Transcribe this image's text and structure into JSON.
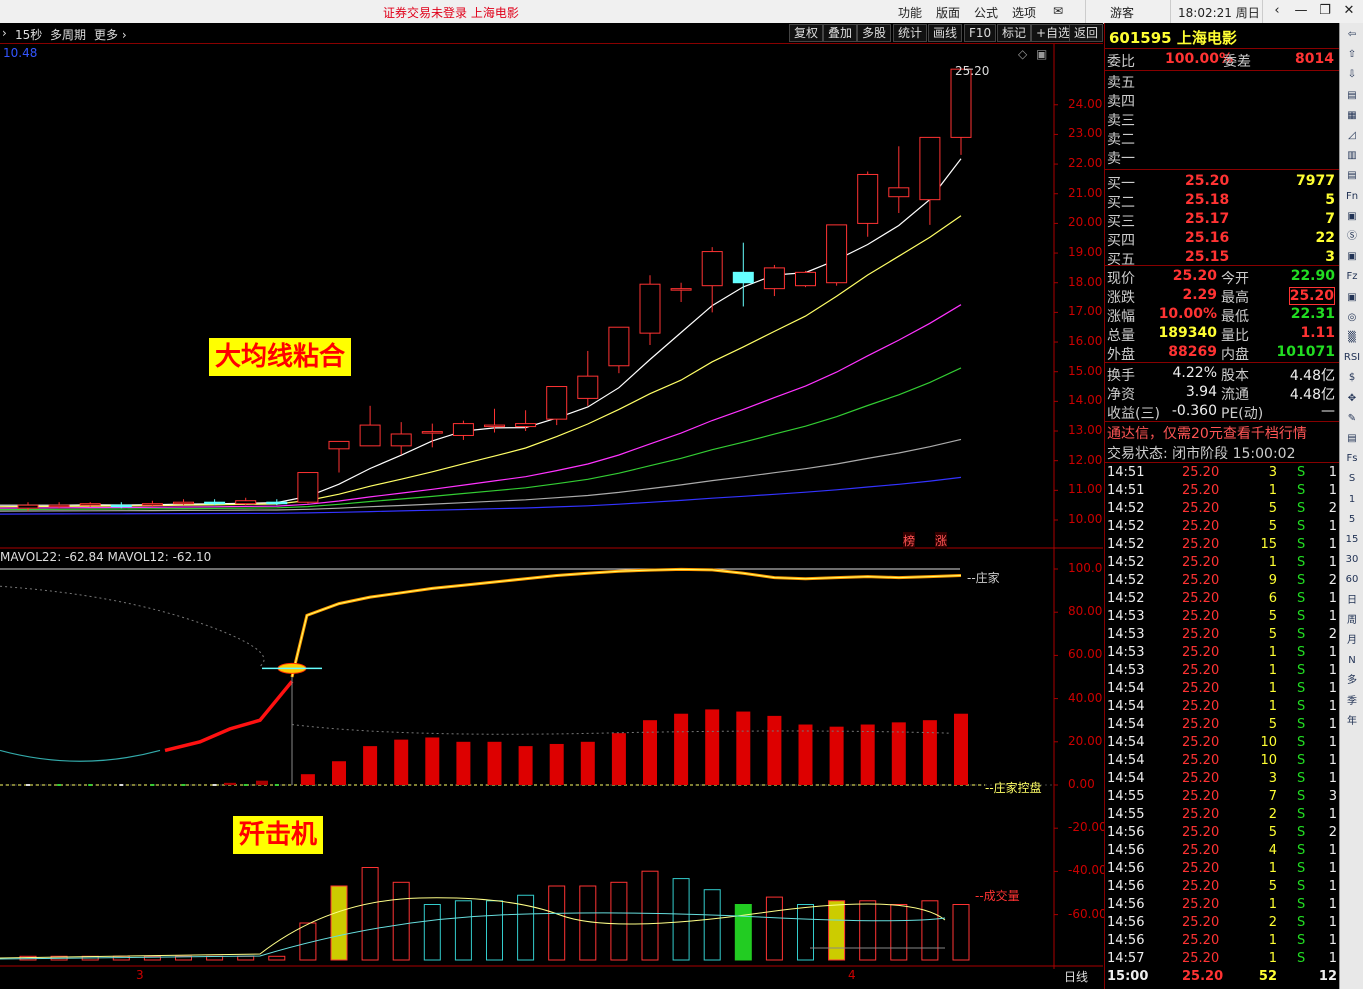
{
  "titlebar": {
    "center_text": "证券交易未登录  上海电影",
    "menu": [
      "功能",
      "版面",
      "公式",
      "选项"
    ],
    "user": "游客",
    "time": "18:02:21 周日"
  },
  "toolbar": {
    "left_items": [
      "15秒",
      "多周期",
      "更多 ›"
    ],
    "buttons": [
      "复权",
      "叠加",
      "多股",
      "统计",
      "画线",
      "F10",
      "标记",
      "+自选",
      "返回"
    ]
  },
  "main_chart": {
    "top_left_value": "10.48",
    "max_price_label": "25.20",
    "price_ticks": [
      "24.00",
      "23.00",
      "22.00",
      "21.00",
      "20.00",
      "19.00",
      "18.00",
      "17.00",
      "16.00",
      "15.00",
      "14.00",
      "13.00",
      "12.00",
      "11.00",
      "10.00"
    ],
    "annotation": "大均线粘合",
    "badges": [
      "榜",
      "涨"
    ]
  },
  "indicator_panel": {
    "header": "MAVOL22: -62.84  MAVOL12: -62.10",
    "ticks": [
      "100.0",
      "80.00",
      "60.00",
      "40.00",
      "20.00",
      "0.00",
      "-20.00",
      "-40.00",
      "-60.00"
    ],
    "label_zhuangjia": "--庄家",
    "label_kongpan": "--庄家控盘",
    "label_volume": "--成交量",
    "annotation": "歼击机",
    "date_labels": [
      "3",
      "4"
    ],
    "period": "日线"
  },
  "quote": {
    "code": "601595",
    "name": "上海电影",
    "weibi_label": "委比",
    "weibi_value": "100.00%",
    "weicha_label": "委差",
    "weicha_value": "8014",
    "sell_labels": [
      "卖五",
      "卖四",
      "卖三",
      "卖二",
      "卖一"
    ],
    "buys": [
      {
        "label": "买一",
        "price": "25.20",
        "vol": "7977"
      },
      {
        "label": "买二",
        "price": "25.18",
        "vol": "5"
      },
      {
        "label": "买三",
        "price": "25.17",
        "vol": "7"
      },
      {
        "label": "买四",
        "price": "25.16",
        "vol": "22"
      },
      {
        "label": "买五",
        "price": "25.15",
        "vol": "3"
      }
    ],
    "stats": [
      {
        "l1": "现价",
        "v1": "25.20",
        "l2": "今开",
        "v2": "22.90"
      },
      {
        "l1": "涨跌",
        "v1": "2.29",
        "l2": "最高",
        "v2": "25.20"
      },
      {
        "l1": "涨幅",
        "v1": "10.00%",
        "l2": "最低",
        "v2": "22.31"
      },
      {
        "l1": "总量",
        "v1": "189340",
        "l2": "量比",
        "v2": "1.11"
      },
      {
        "l1": "外盘",
        "v1": "88269",
        "l2": "内盘",
        "v2": "101071"
      }
    ],
    "stats2": [
      {
        "l1": "换手",
        "v1": "4.22%",
        "l2": "股本",
        "v2": "4.48亿"
      },
      {
        "l1": "净资",
        "v1": "3.94",
        "l2": "流通",
        "v2": "4.48亿"
      },
      {
        "l1": "收益(三)",
        "v1": "-0.360",
        "l2": "PE(动)",
        "v2": "—"
      }
    ],
    "ad": "通达信，仅需20元查看千档行情",
    "status": "交易状态: 闭市阶段 15:00:02"
  },
  "trades": [
    {
      "t": "14:51",
      "p": "25.20",
      "v": "3",
      "s": "S",
      "n": "1"
    },
    {
      "t": "14:51",
      "p": "25.20",
      "v": "1",
      "s": "S",
      "n": "1"
    },
    {
      "t": "14:52",
      "p": "25.20",
      "v": "5",
      "s": "S",
      "n": "2"
    },
    {
      "t": "14:52",
      "p": "25.20",
      "v": "5",
      "s": "S",
      "n": "1"
    },
    {
      "t": "14:52",
      "p": "25.20",
      "v": "15",
      "s": "S",
      "n": "1"
    },
    {
      "t": "14:52",
      "p": "25.20",
      "v": "1",
      "s": "S",
      "n": "1"
    },
    {
      "t": "14:52",
      "p": "25.20",
      "v": "9",
      "s": "S",
      "n": "2"
    },
    {
      "t": "14:52",
      "p": "25.20",
      "v": "6",
      "s": "S",
      "n": "1"
    },
    {
      "t": "14:53",
      "p": "25.20",
      "v": "5",
      "s": "S",
      "n": "1"
    },
    {
      "t": "14:53",
      "p": "25.20",
      "v": "5",
      "s": "S",
      "n": "2"
    },
    {
      "t": "14:53",
      "p": "25.20",
      "v": "1",
      "s": "S",
      "n": "1"
    },
    {
      "t": "14:53",
      "p": "25.20",
      "v": "1",
      "s": "S",
      "n": "1"
    },
    {
      "t": "14:54",
      "p": "25.20",
      "v": "1",
      "s": "S",
      "n": "1"
    },
    {
      "t": "14:54",
      "p": "25.20",
      "v": "1",
      "s": "S",
      "n": "1"
    },
    {
      "t": "14:54",
      "p": "25.20",
      "v": "5",
      "s": "S",
      "n": "1"
    },
    {
      "t": "14:54",
      "p": "25.20",
      "v": "10",
      "s": "S",
      "n": "1"
    },
    {
      "t": "14:54",
      "p": "25.20",
      "v": "10",
      "s": "S",
      "n": "1"
    },
    {
      "t": "14:54",
      "p": "25.20",
      "v": "3",
      "s": "S",
      "n": "1"
    },
    {
      "t": "14:55",
      "p": "25.20",
      "v": "7",
      "s": "S",
      "n": "3"
    },
    {
      "t": "14:55",
      "p": "25.20",
      "v": "2",
      "s": "S",
      "n": "1"
    },
    {
      "t": "14:56",
      "p": "25.20",
      "v": "5",
      "s": "S",
      "n": "2"
    },
    {
      "t": "14:56",
      "p": "25.20",
      "v": "4",
      "s": "S",
      "n": "1"
    },
    {
      "t": "14:56",
      "p": "25.20",
      "v": "1",
      "s": "S",
      "n": "1"
    },
    {
      "t": "14:56",
      "p": "25.20",
      "v": "5",
      "s": "S",
      "n": "1"
    },
    {
      "t": "14:56",
      "p": "25.20",
      "v": "1",
      "s": "S",
      "n": "1"
    },
    {
      "t": "14:56",
      "p": "25.20",
      "v": "2",
      "s": "S",
      "n": "1"
    },
    {
      "t": "14:56",
      "p": "25.20",
      "v": "1",
      "s": "S",
      "n": "1"
    },
    {
      "t": "14:57",
      "p": "25.20",
      "v": "1",
      "s": "S",
      "n": "1"
    },
    {
      "t": "15:00",
      "p": "25.20",
      "v": "52",
      "s": "",
      "n": "12"
    }
  ],
  "side_icons": [
    "⇦",
    "⇧",
    "⇩",
    "▤",
    "▦",
    "◿",
    "▥",
    "▤",
    "Fn",
    "▣",
    "Ⓢ",
    "▣",
    "Fz",
    "▣",
    "◎",
    "▒",
    "RSI",
    "$",
    "✥",
    "✎",
    "▤",
    "Fs",
    "S",
    "1",
    "5",
    "15",
    "30",
    "60",
    "日",
    "周",
    "月",
    "N",
    "多",
    "季",
    "年"
  ],
  "chart_data": {
    "type": "candlestick",
    "candles": [
      {
        "o": 10.4,
        "c": 10.5,
        "h": 10.6,
        "l": 10.3
      },
      {
        "o": 10.45,
        "c": 10.5,
        "h": 10.6,
        "l": 10.4
      },
      {
        "o": 10.5,
        "c": 10.55,
        "h": 10.6,
        "l": 10.45
      },
      {
        "o": 10.5,
        "c": 10.48,
        "h": 10.6,
        "l": 10.4
      },
      {
        "o": 10.5,
        "c": 10.55,
        "h": 10.65,
        "l": 10.45
      },
      {
        "o": 10.55,
        "c": 10.6,
        "h": 10.7,
        "l": 10.5
      },
      {
        "o": 10.6,
        "c": 10.55,
        "h": 10.7,
        "l": 10.5
      },
      {
        "o": 10.55,
        "c": 10.65,
        "h": 10.75,
        "l": 10.5
      },
      {
        "o": 10.6,
        "c": 10.58,
        "h": 10.7,
        "l": 10.5
      },
      {
        "o": 10.6,
        "c": 11.6,
        "h": 11.6,
        "l": 10.55
      },
      {
        "o": 12.4,
        "c": 12.65,
        "h": 12.65,
        "l": 11.6
      },
      {
        "o": 12.5,
        "c": 13.2,
        "h": 13.85,
        "l": 12.5
      },
      {
        "o": 12.5,
        "c": 12.9,
        "h": 13.3,
        "l": 12.2
      },
      {
        "o": 12.95,
        "c": 12.98,
        "h": 13.25,
        "l": 12.45
      },
      {
        "o": 12.85,
        "c": 13.25,
        "h": 13.35,
        "l": 12.7
      },
      {
        "o": 13.15,
        "c": 13.2,
        "h": 13.75,
        "l": 12.95
      },
      {
        "o": 13.15,
        "c": 13.25,
        "h": 13.7,
        "l": 13.0
      },
      {
        "o": 13.4,
        "c": 14.5,
        "h": 14.5,
        "l": 13.2
      },
      {
        "o": 14.1,
        "c": 14.85,
        "h": 15.7,
        "l": 13.85
      },
      {
        "o": 15.2,
        "c": 16.5,
        "h": 16.5,
        "l": 14.95
      },
      {
        "o": 16.3,
        "c": 17.95,
        "h": 18.25,
        "l": 15.9
      },
      {
        "o": 17.75,
        "c": 17.8,
        "h": 18.0,
        "l": 17.35
      },
      {
        "o": 17.9,
        "c": 19.05,
        "h": 19.2,
        "l": 17.0
      },
      {
        "o": 18.35,
        "c": 18.0,
        "h": 19.35,
        "l": 17.2
      },
      {
        "o": 17.8,
        "c": 18.5,
        "h": 18.6,
        "l": 17.55
      },
      {
        "o": 17.9,
        "c": 18.35,
        "h": 18.4,
        "l": 17.85
      },
      {
        "o": 18.0,
        "c": 19.95,
        "h": 19.95,
        "l": 17.9
      },
      {
        "o": 20.0,
        "c": 21.65,
        "h": 21.75,
        "l": 19.55
      },
      {
        "o": 20.9,
        "c": 21.2,
        "h": 22.6,
        "l": 20.35
      },
      {
        "o": 20.8,
        "c": 22.9,
        "h": 22.9,
        "l": 19.95
      },
      {
        "o": 22.9,
        "c": 25.2,
        "h": 25.2,
        "l": 22.31
      }
    ],
    "ma_series": [
      {
        "name": "ma5",
        "color": "#ffffff"
      },
      {
        "name": "ma10",
        "color": "#ffff66"
      },
      {
        "name": "ma20",
        "color": "#ff33ff"
      },
      {
        "name": "ma30",
        "color": "#33cc33"
      },
      {
        "name": "ma60",
        "color": "#aaaaaa"
      },
      {
        "name": "ma120",
        "color": "#3333ff"
      }
    ],
    "ylim": [
      9.75,
      25.35
    ],
    "zhuangjia_curve": [
      null,
      null,
      null,
      null,
      null,
      null,
      null,
      null,
      null,
      78.5,
      84,
      87,
      89,
      91,
      92.5,
      94,
      95.5,
      97,
      98,
      99,
      99.5,
      99.8,
      99.6,
      98,
      96,
      95.5,
      96,
      96.5,
      96,
      96.5,
      97
    ],
    "control_line": [
      6,
      5,
      4,
      3,
      2,
      2,
      3,
      5,
      10,
      22,
      24,
      28,
      30,
      48,
      null,
      null,
      null,
      null,
      null,
      null,
      null,
      null,
      null,
      null,
      null,
      null,
      null,
      null,
      null,
      null,
      null
    ],
    "kongpan_bars": [
      0,
      0,
      0,
      0,
      0,
      0,
      0,
      0,
      0,
      5,
      11,
      18,
      21,
      22,
      20,
      20,
      18,
      19,
      20,
      24,
      30,
      33,
      35,
      34,
      32,
      28,
      27,
      28,
      29,
      30,
      33
    ],
    "volume_bars": [
      2,
      2,
      2,
      2,
      2,
      2,
      2,
      2,
      2,
      20,
      40,
      50,
      42,
      30,
      32,
      32,
      35,
      40,
      40,
      42,
      48,
      44,
      38,
      30,
      34,
      30,
      32,
      32,
      30,
      32,
      30
    ],
    "volume_colors": [
      "r",
      "r",
      "r",
      "r",
      "r",
      "r",
      "r",
      "r",
      "r",
      "r",
      "y",
      "r",
      "r",
      "c",
      "c",
      "c",
      "c",
      "r",
      "r",
      "r",
      "r",
      "c",
      "c",
      "g",
      "r",
      "c",
      "y",
      "r",
      "r",
      "r",
      "r"
    ]
  }
}
